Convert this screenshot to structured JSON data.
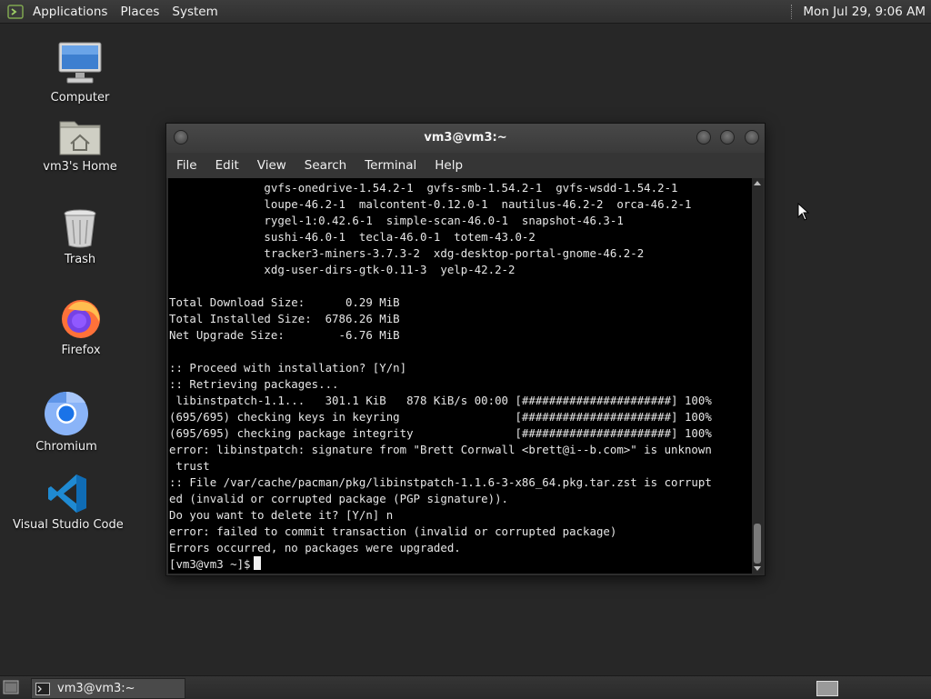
{
  "top_panel": {
    "menus": [
      "Applications",
      "Places",
      "System"
    ],
    "clock": "Mon Jul 29,  9:06 AM"
  },
  "desktop_icons": [
    {
      "label": "Computer",
      "icon": "computer-icon"
    },
    {
      "label": "vm3's Home",
      "icon": "home-folder-icon"
    },
    {
      "label": "Trash",
      "icon": "trash-icon"
    },
    {
      "label": "Firefox",
      "icon": "firefox-icon"
    },
    {
      "label": "Chromium",
      "icon": "chromium-icon"
    },
    {
      "label": "Visual Studio Code",
      "icon": "vscode-icon"
    }
  ],
  "terminal": {
    "title": "vm3@vm3:~",
    "menus": [
      "File",
      "Edit",
      "View",
      "Search",
      "Terminal",
      "Help"
    ],
    "output": "              gvfs-onedrive-1.54.2-1  gvfs-smb-1.54.2-1  gvfs-wsdd-1.54.2-1\n              loupe-46.2-1  malcontent-0.12.0-1  nautilus-46.2-2  orca-46.2-1\n              rygel-1:0.42.6-1  simple-scan-46.0-1  snapshot-46.3-1\n              sushi-46.0-1  tecla-46.0-1  totem-43.0-2\n              tracker3-miners-3.7.3-2  xdg-desktop-portal-gnome-46.2-2\n              xdg-user-dirs-gtk-0.11-3  yelp-42.2-2\n\nTotal Download Size:      0.29 MiB\nTotal Installed Size:  6786.26 MiB\nNet Upgrade Size:        -6.76 MiB\n\n:: Proceed with installation? [Y/n]\n:: Retrieving packages...\n libinstpatch-1.1...   301.1 KiB   878 KiB/s 00:00 [######################] 100%\n(695/695) checking keys in keyring                 [######################] 100%\n(695/695) checking package integrity               [######################] 100%\nerror: libinstpatch: signature from \"Brett Cornwall <brett@i--b.com>\" is unknown\n trust\n:: File /var/cache/pacman/pkg/libinstpatch-1.1.6-3-x86_64.pkg.tar.zst is corrupt\ned (invalid or corrupted package (PGP signature)).\nDo you want to delete it? [Y/n] n\nerror: failed to commit transaction (invalid or corrupted package)\nErrors occurred, no packages were upgraded.",
    "prompt": "[vm3@vm3 ~]$"
  },
  "taskbar": {
    "task_label": "vm3@vm3:~"
  }
}
